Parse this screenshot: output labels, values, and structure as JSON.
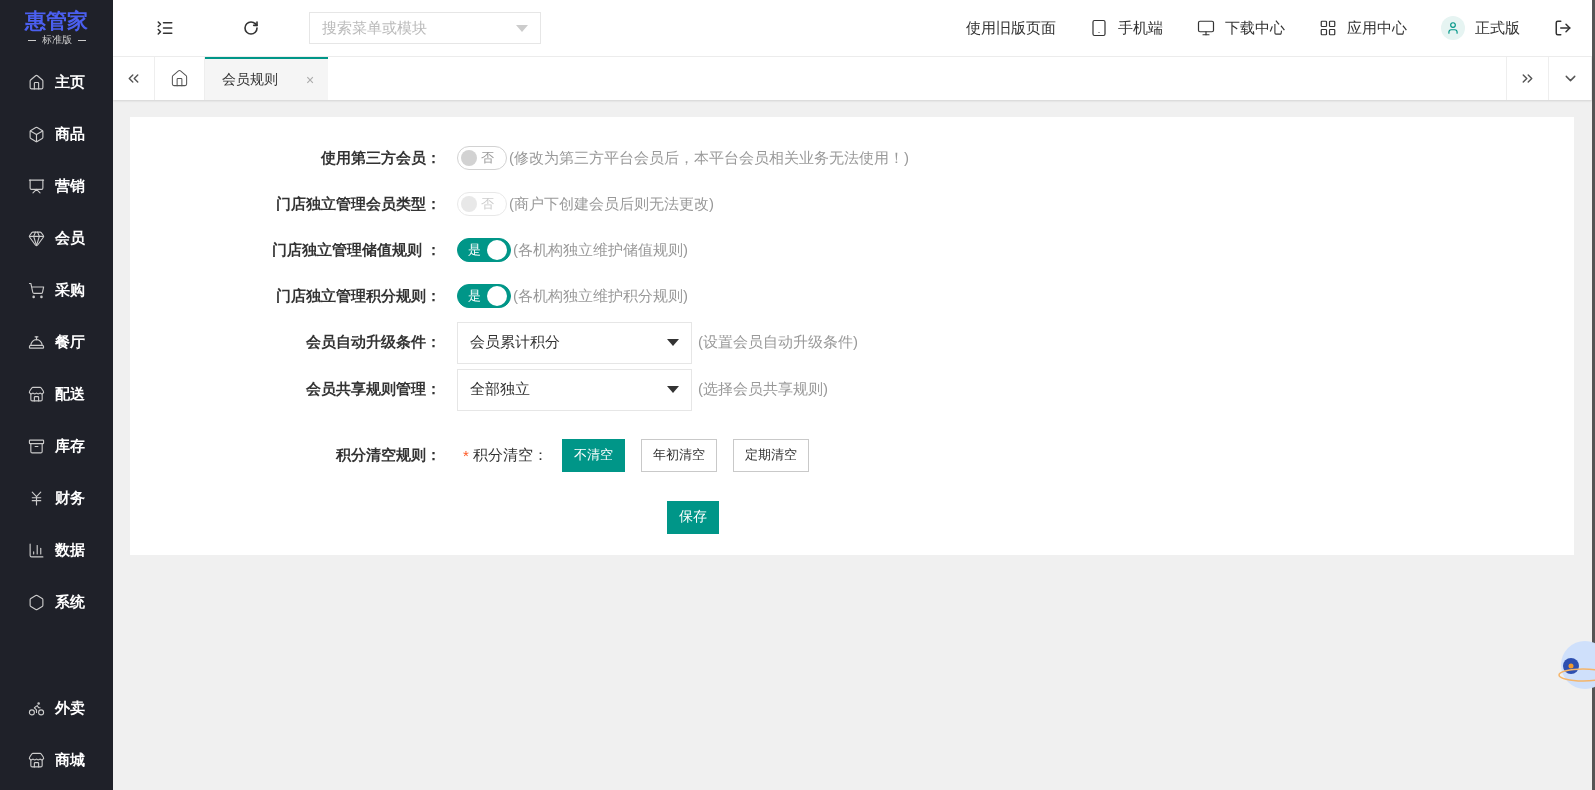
{
  "logo": {
    "name": "惠管家",
    "edition": "标准版"
  },
  "sidebar": {
    "items": [
      {
        "label": "主页",
        "selected": false
      },
      {
        "label": "商品",
        "selected": false
      },
      {
        "label": "营销",
        "selected": false
      },
      {
        "label": "会员",
        "selected": false
      },
      {
        "label": "采购",
        "selected": false
      },
      {
        "label": "餐厅",
        "selected": false
      },
      {
        "label": "配送",
        "selected": false
      },
      {
        "label": "库存",
        "selected": false
      },
      {
        "label": "财务",
        "selected": false
      },
      {
        "label": "数据",
        "selected": false
      },
      {
        "label": "系统",
        "selected": false
      }
    ],
    "bottom_items": [
      {
        "label": "外卖",
        "selected": false
      },
      {
        "label": "商城",
        "selected": false
      }
    ]
  },
  "topbar": {
    "search": {
      "placeholder": "搜索菜单或模块"
    },
    "links": [
      {
        "label": "使用旧版页面"
      },
      {
        "label": "手机端"
      },
      {
        "label": "下载中心"
      },
      {
        "label": "应用中心"
      },
      {
        "label": "正式版"
      }
    ]
  },
  "tabs": [
    {
      "label": "会员规则",
      "selected": true,
      "close": "×"
    }
  ],
  "form": {
    "rows": [
      {
        "kind": "toggle",
        "label": "使用第三方会员：",
        "on": false,
        "disabled": false,
        "text": "否",
        "hint": "(修改为第三方平台会员后，本平台会员相关业务无法使用！)"
      },
      {
        "kind": "toggle",
        "label": "门店独立管理会员类型：",
        "on": false,
        "disabled": true,
        "text": "否",
        "hint": "(商户下创建会员后则无法更改)"
      },
      {
        "kind": "toggle",
        "label": "门店独立管理储值规则 ：",
        "on": true,
        "disabled": false,
        "text": "是",
        "hint": "(各机构独立维护储值规则)"
      },
      {
        "kind": "toggle",
        "label": "门店独立管理积分规则：",
        "on": true,
        "disabled": false,
        "text": "是",
        "hint": "(各机构独立维护积分规则)"
      },
      {
        "kind": "select",
        "label": "会员自动升级条件：",
        "value": "会员累计积分",
        "hint": "(设置会员自动升级条件)"
      },
      {
        "kind": "select",
        "label": "会员共享规则管理：",
        "value": "全部独立",
        "hint": "(选择会员共享规则)"
      },
      {
        "kind": "choice",
        "label": "积分清空规则：",
        "required_mark": "*",
        "sublabel": "积分清空：",
        "options": [
          {
            "label": "不清空",
            "selected": true
          },
          {
            "label": "年初清空",
            "selected": false
          },
          {
            "label": "定期清空",
            "selected": false
          }
        ]
      }
    ],
    "save": "保存"
  }
}
